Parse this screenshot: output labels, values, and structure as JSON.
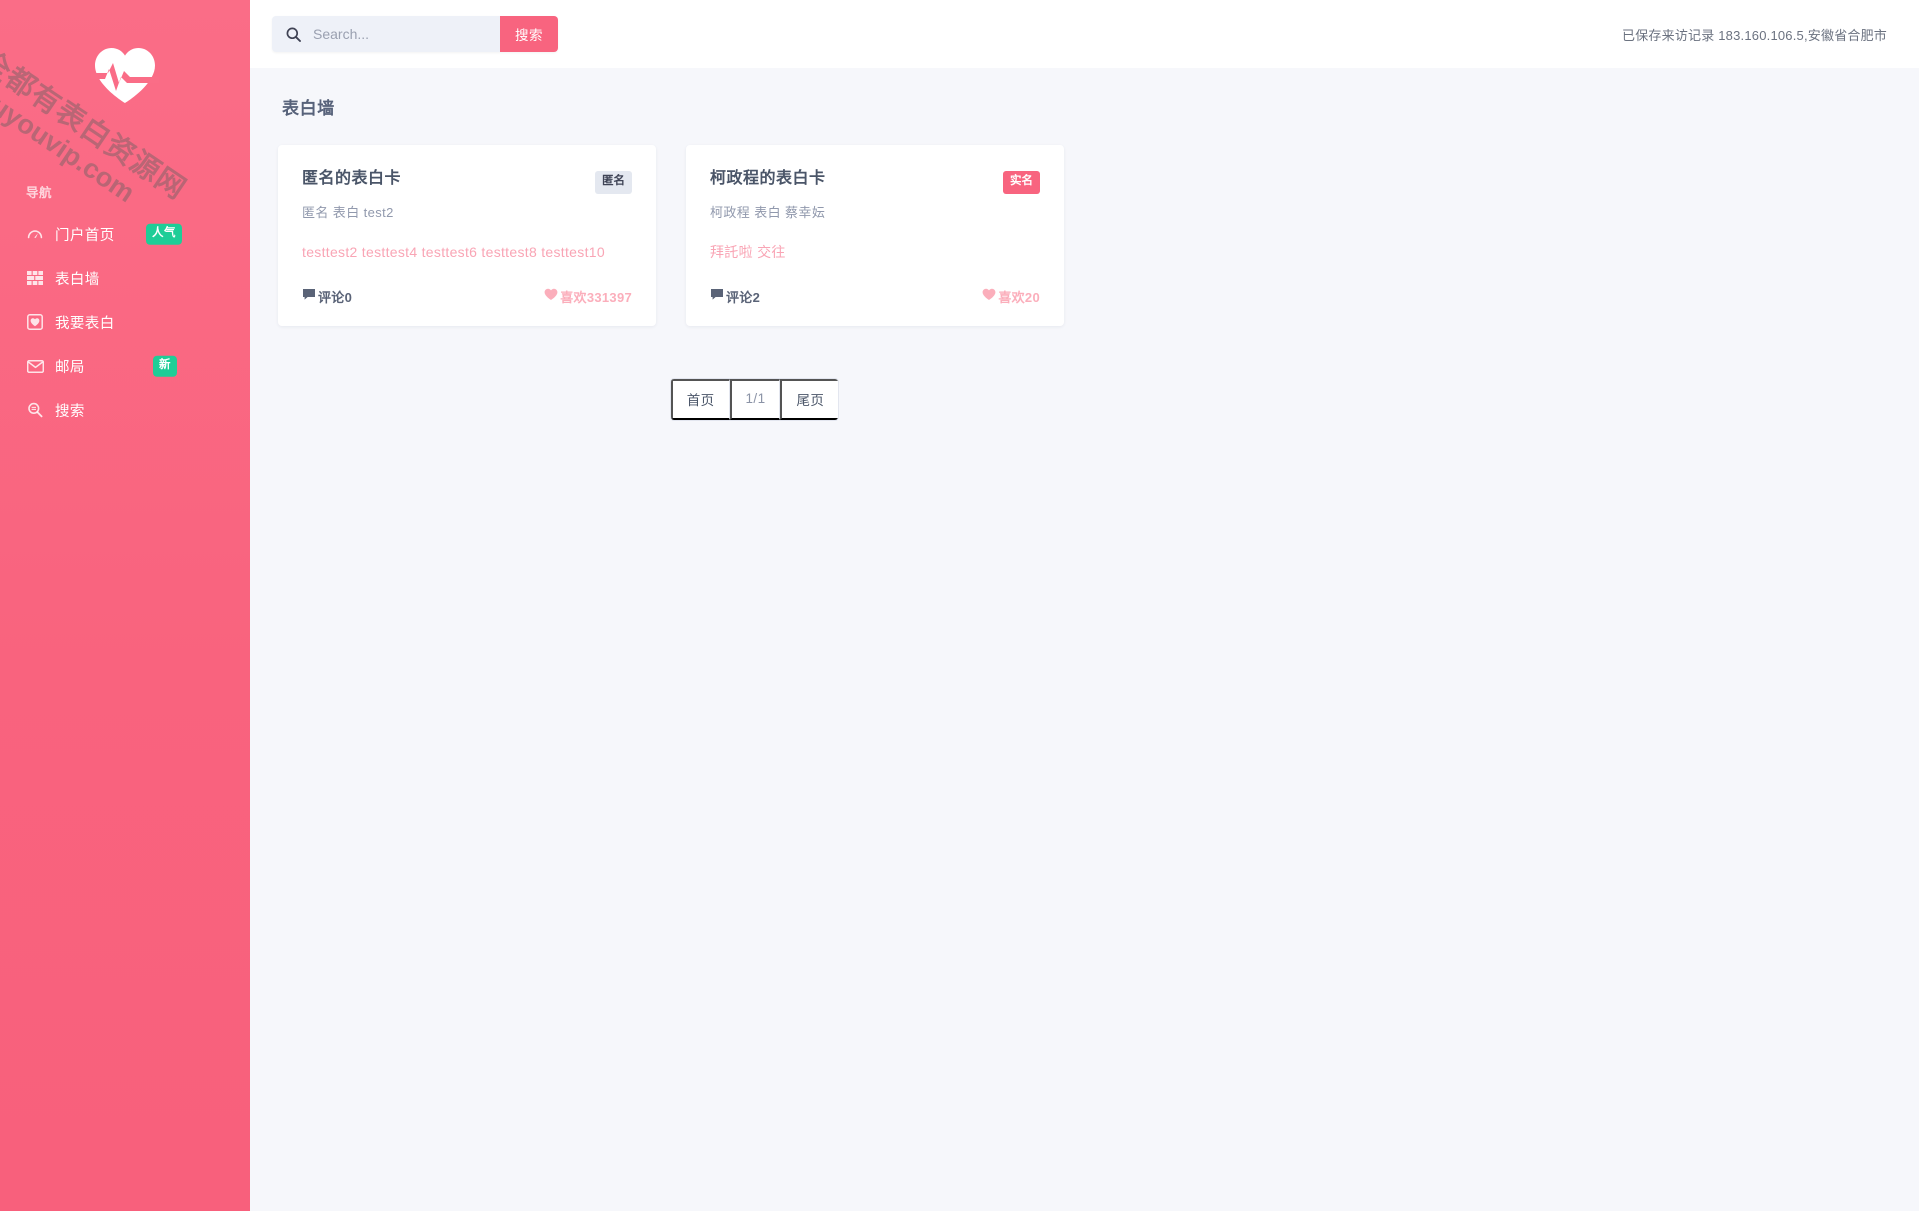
{
  "sidebar": {
    "logo_icon": "heartbeat-heart-icon",
    "watermark": {
      "line1": "全都有表白资源网",
      "line2": "douyouvip.com"
    },
    "nav_heading": "导航",
    "items": [
      {
        "label": "门户首页",
        "icon": "tachometer-icon",
        "badge": "人气"
      },
      {
        "label": "表白墙",
        "icon": "wall-grid-icon",
        "badge": ""
      },
      {
        "label": "我要表白",
        "icon": "heart-square-icon",
        "badge": ""
      },
      {
        "label": "邮局",
        "icon": "envelope-icon",
        "badge": "新"
      },
      {
        "label": "搜索",
        "icon": "search-glass-icon",
        "badge": ""
      }
    ]
  },
  "topbar": {
    "search": {
      "icon": "search-icon",
      "placeholder": "Search...",
      "value": "",
      "button_label": "搜索"
    },
    "visit_record": "已保存来访记录 183.160.106.5,安徽省合肥市"
  },
  "main": {
    "page_title": "表白墙",
    "cards": [
      {
        "title": "匿名的表白卡",
        "tag": "匿名",
        "tag_style": "anon",
        "subtitle": "匿名 表白 test2",
        "body": "testtest2 testtest4 testtest6 testtest8 testtest10",
        "comment_icon": "comment-icon",
        "comment_label": "评论0",
        "like_icon": "heart-icon",
        "like_label": "喜欢331397"
      },
      {
        "title": "柯政程的表白卡",
        "tag": "实名",
        "tag_style": "real",
        "subtitle": "柯政程 表白 蔡幸妘",
        "body": "拜託啦 交往",
        "comment_icon": "comment-icon",
        "comment_label": "评论2",
        "like_icon": "heart-icon",
        "like_label": "喜欢20"
      }
    ],
    "pagination": {
      "first_label": "首页",
      "current_label": "1/1",
      "last_label": "尾页"
    }
  },
  "colors": {
    "brand_pink": "#f8647f",
    "sidebar_gradient_start": "#fa6d87",
    "sidebar_gradient_end": "#f8607c",
    "badge_green": "#1ecd97",
    "content_bg": "#f6f7fb",
    "card_bg": "#ffffff",
    "body_text_pink": "#f9a5b5"
  }
}
